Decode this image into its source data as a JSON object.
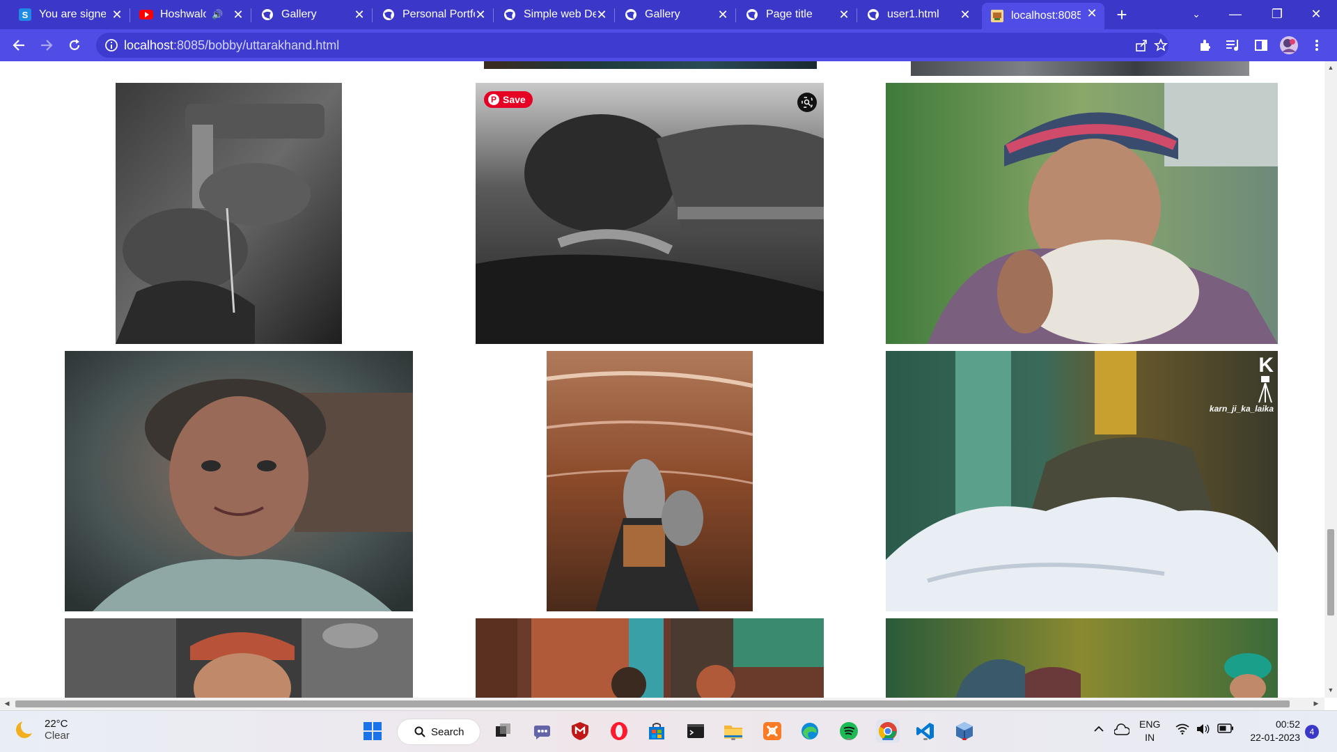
{
  "browser": {
    "tabs": [
      {
        "title": "You are signed",
        "icon": "skype-s-icon",
        "active": false
      },
      {
        "title": "Hoshwalo",
        "icon": "youtube-icon",
        "active": false,
        "audio": true
      },
      {
        "title": "Gallery",
        "icon": "globe-icon",
        "active": false
      },
      {
        "title": "Personal Portfo",
        "icon": "globe-icon",
        "active": false
      },
      {
        "title": "Simple web De",
        "icon": "globe-icon",
        "active": false
      },
      {
        "title": "Gallery",
        "icon": "globe-icon",
        "active": false
      },
      {
        "title": "Page title",
        "icon": "globe-icon",
        "active": false
      },
      {
        "title": "user1.html",
        "icon": "globe-icon",
        "active": false
      },
      {
        "title": "localhost:8085",
        "icon": "xampp-favicon-icon",
        "active": true
      }
    ],
    "url_host": "localhost",
    "url_rest": ":8085/bobby/uttarakhand.html"
  },
  "gallery": {
    "save_label": "Save",
    "watermark": "karn_ji_ka_laika",
    "watermark_letter": "K"
  },
  "taskbar": {
    "weather_temp": "22°C",
    "weather_cond": "Clear",
    "search_label": "Search",
    "lang_top": "ENG",
    "lang_bottom": "IN",
    "time": "00:52",
    "date": "22-01-2023",
    "notif_count": "4"
  },
  "colors": {
    "chrome_tabstrip": "#3a37c9",
    "chrome_toolbar": "#4f4de6",
    "pinterest_red": "#e60023"
  }
}
